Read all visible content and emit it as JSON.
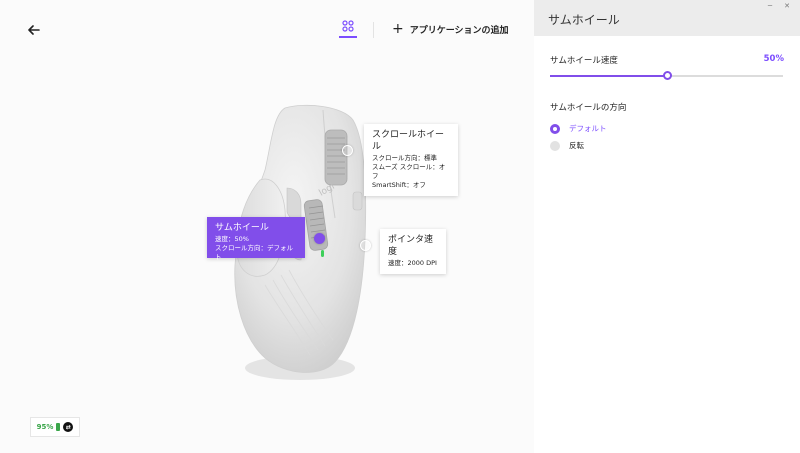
{
  "header": {
    "add_app_label": "アプリケーションの追加"
  },
  "callouts": {
    "scroll_wheel": {
      "title": "スクロールホイール",
      "line1": "スクロール方向：標準",
      "line2": "スムーズ スクロール：オフ",
      "line3": "SmartShift：オフ"
    },
    "thumb_wheel": {
      "title": "サムホイール",
      "line1": "速度：50%",
      "line2": "スクロール方向：デフォルト"
    },
    "pointer_speed": {
      "title": "ポインタ速度",
      "line1": "速度：2000 DPI"
    }
  },
  "battery": {
    "percent": "95%"
  },
  "panel": {
    "title": "サムホイール",
    "speed_label": "サムホイール速度",
    "speed_value": "50%",
    "speed_fraction": 0.5,
    "direction_title": "サムホイールの方向",
    "direction_options": [
      {
        "label": "デフォルト",
        "selected": true
      },
      {
        "label": "反転",
        "selected": false
      }
    ]
  },
  "window_controls": {
    "minimize": "─",
    "close": "✕"
  },
  "colors": {
    "accent": "#814eea",
    "battery": "#3aa64a"
  },
  "icons": [
    "back-arrow-icon",
    "apps-grid-icon",
    "plus-icon",
    "battery-icon",
    "flow-icon"
  ]
}
